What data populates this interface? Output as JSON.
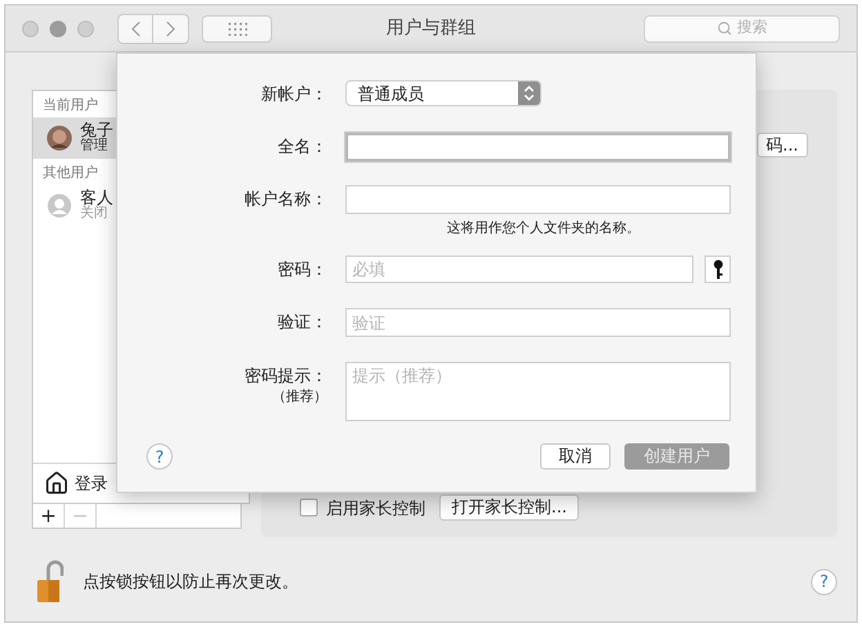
{
  "window": {
    "title": "用户与群组",
    "help": "?"
  },
  "search": {
    "placeholder": "搜索"
  },
  "sidebar": {
    "sections": [
      {
        "header": "当前用户",
        "users": [
          {
            "name": "兔子",
            "role": "管理",
            "selected": true
          }
        ]
      },
      {
        "header": "其他用户",
        "users": [
          {
            "name": "客人",
            "role": "关闭",
            "selected": false,
            "kind": "generic"
          }
        ]
      }
    ],
    "login_options": "登录",
    "buttons": [
      {
        "label": "+",
        "disabled": false
      },
      {
        "label": "−",
        "disabled": true
      }
    ]
  },
  "detail": {
    "button": "码...",
    "parental_controls": {
      "label": "启用家长控制",
      "checked": false
    },
    "open_parental_button": "打开家长控制..."
  },
  "lock": {
    "text": "点按锁按钮以防止再次更改。",
    "locked": false
  },
  "sheet": {
    "fields": [
      {
        "kind": "popup",
        "label": "新帐户：",
        "value": "普通成员",
        "focused": false
      },
      {
        "kind": "text",
        "label": "全名：",
        "focused": true
      },
      {
        "kind": "text",
        "label": "帐户名称：",
        "note": "这将用作您个人文件夹的名称。",
        "focused": false
      },
      {
        "kind": "password",
        "label": "密码：",
        "placeholder": "必填",
        "focused": false
      },
      {
        "kind": "text",
        "label": "验证：",
        "placeholder": "验证",
        "focused": false
      },
      {
        "kind": "textarea",
        "label": "密码提示：",
        "sublabel": "（推荐）",
        "placeholder": "提示（推荐）",
        "focused": false
      }
    ],
    "help": "?",
    "buttons": [
      {
        "label": "取消",
        "disabled": false
      },
      {
        "label": "创建用户",
        "disabled": true
      }
    ]
  }
}
